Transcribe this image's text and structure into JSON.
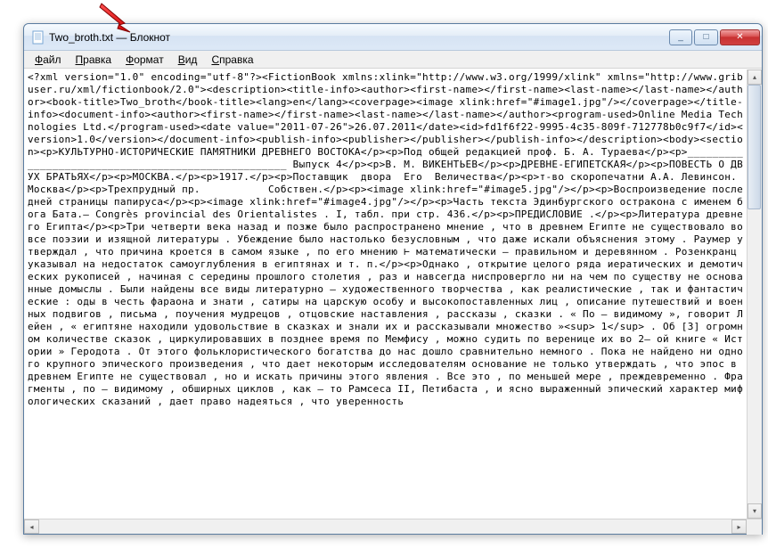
{
  "window": {
    "title": "Two_broth.txt — Блокнот",
    "app_name": "Блокнот",
    "file_name": "Two_broth.txt"
  },
  "menu": {
    "file": "Файл",
    "edit": "Правка",
    "format": "Формат",
    "view": "Вид",
    "help": "Справка"
  },
  "win_controls": {
    "minimize": "_",
    "maximize": "□",
    "close": "✕"
  },
  "scroll": {
    "up": "▴",
    "down": "▾",
    "left": "◂",
    "right": "▸"
  },
  "document_text": "<?xml version=\"1.0\" encoding=\"utf-8\"?><FictionBook xmlns:xlink=\"http://www.w3.org/1999/xlink\" xmlns=\"http://www.gribuser.ru/xml/fictionbook/2.0\"><description><title-info><author><first-name></first-name><last-name></last-name></author><book-title>Two_broth</book-title><lang>en</lang><coverpage><image xlink:href=\"#image1.jpg\"/></coverpage></title-info><document-info><author><first-name></first-name><last-name></last-name></author><program-used>Online Media Technologies Ltd.</program-used><date value=\"2011-07-26\">26.07.2011</date><id>fd1f6f22-9995-4c35-809f-712778b0c9f7</id><version>1.0</version></document-info><publish-info><publisher></publisher></publish-info></description><body><section><p>КУЛЬТУРНО-ИСТОРИЧЕСКИЕ ПАМЯТНИКИ ДРЕВНЕГО ВОСТОКА</p><p>Под общей редакцией проф. Б. А. Тураева</p><p>___________________________________________________ Выпуск 4</p><p>В. М. ВИКЕНТЬЕВ</p><p>ДРЕВНЕ-ЕГИПЕТСКАЯ</p><p>ПОВЕСТЬ О ДВУХ БРАТЬЯХ</p><p>МОСКВА.</p><p>1917.</p><p>Поставщик  двора  Его  Величества</p><p>т-во скоропечатни А.А. Левинсон. Москва</p><p>Трехпрудный пр.           Собствен.</p><p><image xlink:href=\"#image5.jpg\"/></p><p>Воспроизведение последней страницы папируса</p><p><image xlink:href=\"#image4.jpg\"/></p><p>Часть текста Эдинбургского остракона с именем бога Бата.— Congrès provincial des Orientalistes . I, табл. при стр. 436.</p><p>ПРЕДИСЛОВИЕ .</p><p>Литература древнего Египта</p><p>Три четверти века назад и позже было распространено мнение , что в древнем Египте не существовало вовсе поэзии и изящной литературы . Убеждение было настолько безусловным , что даже искали объяснения этому . Раумер утверждал , что причина кроется в самом языке , по его мнению ⊢ математически – правильном и деревянном . Розенкранц указывал на недостаток самоуглубления в египтянах и т. п.</p><p>Однако , открытие целого ряда иератических и демотических рукописей , начиная с середины прошлого столетия , раз и навсегда ниспровергло ни на чем по существу не основанные домыслы . Были найдены все виды литературно – художественного творчества , как реалистические , так и фантастические : оды в честь фараона и знати , сатиры на царскую особу и высокопоставленных лиц , описание путешествий и военных подвигов , письма , поучения мудрецов , отцовские наставления , рассказы , сказки . « По – видимому », говорит Лейен , « египтяне находили удовольствие в сказках и знали их и рассказывали множество »<sup> 1</sup> . Об [3] огромном количестве сказок , циркулировавших в позднее время по Мемфису , можно судить по веренице их во 2– ой книге « Истории » Геродота . От этого фольклористического богатства до нас дошло сравнительно немного . Пока не найдено ни одного крупного эпического произведения , что дает некоторым исследователям основание не только утверждать , что эпос в древнем Египте не существовал , но и искать причины этого явления . Все это , по меньшей мере , преждевременно . Фрагменты , по – видимому , обширных циклов , как – то Рамсеса II, Петибаста , и ясно выраженный эпический характер мифологических сказаний , дает право надеяться , что уверенность"
}
